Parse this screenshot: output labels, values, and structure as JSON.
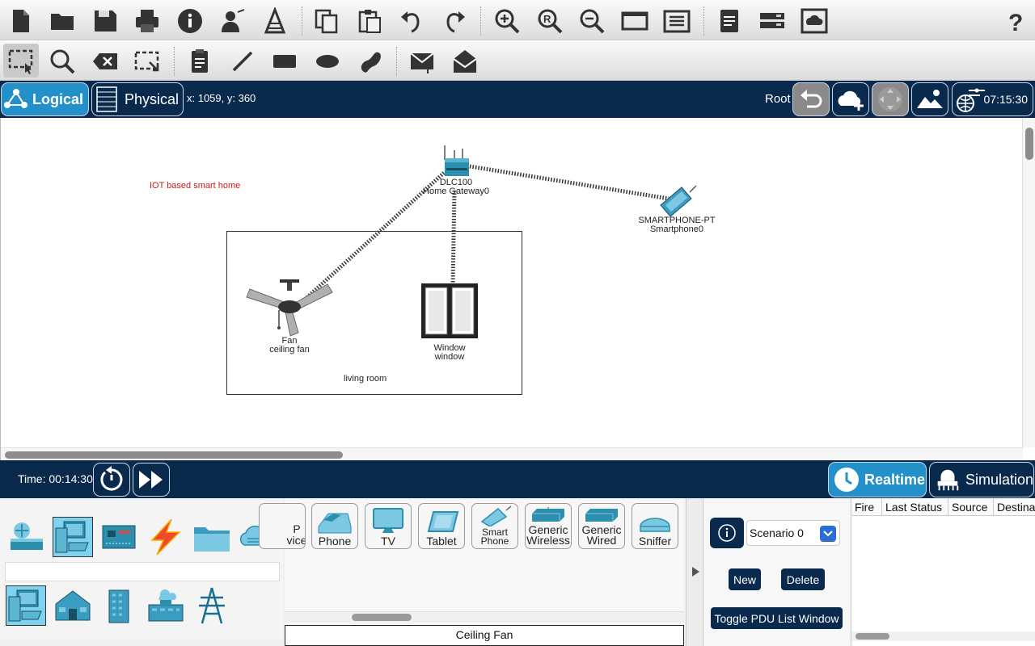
{
  "navbar": {
    "logical_label": "Logical",
    "physical_label": "Physical",
    "coords": "x: 1059, y: 360",
    "root_label": "Root",
    "clock": "07:15:30"
  },
  "workspace": {
    "note": "IOT based smart home",
    "room_label": "living room",
    "devices": {
      "gateway": {
        "model": "DLC100",
        "name": "Home Gateway0"
      },
      "smartphone": {
        "model": "SMARTPHONE-PT",
        "name": "Smartphone0"
      },
      "fan": {
        "model": "Fan",
        "name": "ceiling fan"
      },
      "window": {
        "model": "Window",
        "name": "window"
      }
    }
  },
  "simbar": {
    "time": "Time: 00:14:30",
    "realtime_label": "Realtime",
    "simulation_label": "Simulation"
  },
  "device_tiles": [
    {
      "label": "P\nvice",
      "icon": "partial-device-icon"
    },
    {
      "label": "Phone",
      "icon": "phone-icon"
    },
    {
      "label": "TV",
      "icon": "tv-icon"
    },
    {
      "label": "Tablet",
      "icon": "tablet-icon"
    },
    {
      "label": "Smart\nPhone",
      "icon": "smartphone-icon"
    },
    {
      "label": "Generic\nWireless",
      "icon": "wireless-icon"
    },
    {
      "label": "Generic\nWired",
      "icon": "wired-icon"
    },
    {
      "label": "Sniffer",
      "icon": "sniffer-icon"
    }
  ],
  "selected_device_name": "Ceiling Fan",
  "scenario": {
    "selected": "Scenario 0",
    "new_label": "New",
    "delete_label": "Delete",
    "toggle_label": "Toggle PDU List Window"
  },
  "pdu_table": {
    "columns": [
      "Fire",
      "Last Status",
      "Source",
      "Destina"
    ]
  },
  "colors": {
    "navy": "#0a2a4d",
    "accent_blue": "#2490c9",
    "note_red": "#d21a1a"
  }
}
